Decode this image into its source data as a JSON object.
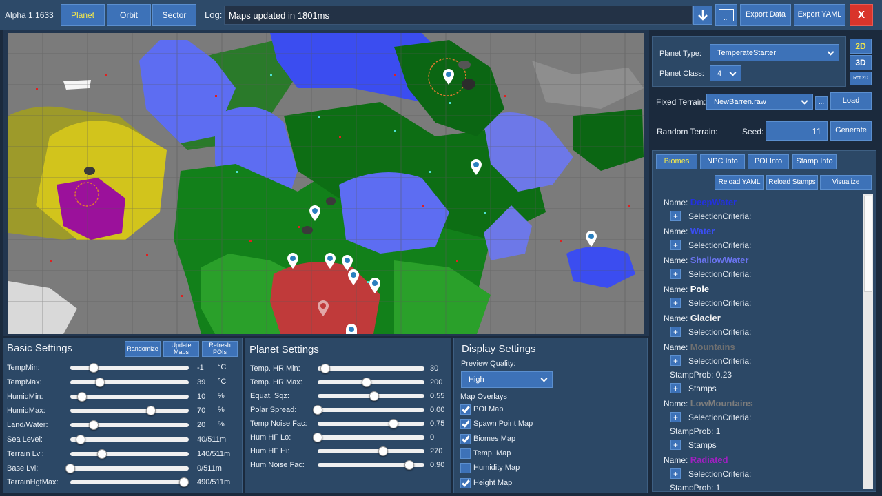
{
  "top_bar": {
    "version": "Alpha 1.1633",
    "tabs": [
      {
        "label": "Planet"
      },
      {
        "label": "Orbit"
      },
      {
        "label": "Sector"
      }
    ],
    "log_label": "Log:",
    "log_text": "Maps updated in 1801ms",
    "browse_label": "...",
    "export_data_label": "Export Data",
    "export_yaml_label": "Export YAML",
    "close_label": "X"
  },
  "planet_config": {
    "planet_type_label": "Planet Type:",
    "planet_type_value": "TemperateStarter",
    "planet_class_label": "Planet Class:",
    "planet_class_value": "4",
    "view_2d_label": "2D",
    "view_3d_label": "3D",
    "rot_2d_label": "Rot 2D",
    "fixed_terrain_label": "Fixed Terrain:",
    "fixed_terrain_value": "NewBarren.raw",
    "browse_label": "...",
    "load_label": "Load",
    "random_terrain_label": "Random Terrain:",
    "seed_label": "Seed:",
    "seed_value": "11",
    "generate_label": "Generate"
  },
  "info_tabs": [
    {
      "label": "Biomes"
    },
    {
      "label": "NPC Info"
    },
    {
      "label": "POI Info"
    },
    {
      "label": "Stamp Info"
    }
  ],
  "info_actions": {
    "reload_yaml": "Reload YAML",
    "reload_stamps": "Reload Stamps",
    "visualize": "Visualize"
  },
  "biomes": {
    "name_label": "Name:",
    "plus": "+",
    "rows": [
      {
        "kind": "name",
        "value": "DeepWater",
        "color": "#2230e0"
      },
      {
        "kind": "sub",
        "value": "SelectionCriteria:",
        "plus": true
      },
      {
        "kind": "name",
        "value": "Water",
        "color": "#3a4ef5"
      },
      {
        "kind": "sub",
        "value": "SelectionCriteria:",
        "plus": true
      },
      {
        "kind": "name",
        "value": "ShallowWater",
        "color": "#6a74f0"
      },
      {
        "kind": "sub",
        "value": "SelectionCriteria:",
        "plus": true
      },
      {
        "kind": "name",
        "value": "Pole",
        "color": "#ffffff"
      },
      {
        "kind": "sub",
        "value": "SelectionCriteria:",
        "plus": true
      },
      {
        "kind": "name",
        "value": "Glacier",
        "color": "#f4f4f4"
      },
      {
        "kind": "sub",
        "value": "SelectionCriteria:",
        "plus": true
      },
      {
        "kind": "name",
        "value": "Mountains",
        "color": "#707070"
      },
      {
        "kind": "sub",
        "value": "SelectionCriteria:",
        "plus": true
      },
      {
        "kind": "prop",
        "value": "StampProb: 0.23"
      },
      {
        "kind": "sub",
        "value": "Stamps",
        "plus": true
      },
      {
        "kind": "name",
        "value": "LowMountains",
        "color": "#7c7c7c"
      },
      {
        "kind": "sub",
        "value": "SelectionCriteria:",
        "plus": true
      },
      {
        "kind": "prop",
        "value": "StampProb: 1"
      },
      {
        "kind": "sub",
        "value": "Stamps",
        "plus": true
      },
      {
        "kind": "name",
        "value": "Radiated",
        "color": "#a020c0"
      },
      {
        "kind": "sub",
        "value": "SelectionCriteria:",
        "plus": true
      },
      {
        "kind": "prop",
        "value": "StampProb: 1"
      }
    ]
  },
  "basic_settings": {
    "title": "Basic Settings",
    "randomize_label": "Randomize",
    "update_maps_label": "Update Maps",
    "refresh_pois_label": "Refresh POIs",
    "sliders": [
      {
        "label": "TempMin:",
        "value": "-1",
        "unit": "°C",
        "level": 0.2
      },
      {
        "label": "TempMax:",
        "value": "39",
        "unit": "°C",
        "level": 0.25
      },
      {
        "label": "HumidMin:",
        "value": "10",
        "unit": "%",
        "level": 0.1
      },
      {
        "label": "HumidMax:",
        "value": "70",
        "unit": "%",
        "level": 0.68
      },
      {
        "label": "Land/Water:",
        "value": "20",
        "unit": "%",
        "level": 0.2
      },
      {
        "label": "Sea Level:",
        "value": "40/511m",
        "unit": "",
        "level": 0.09
      },
      {
        "label": "Terrain Lvl:",
        "value": "140/511m",
        "unit": "",
        "level": 0.27
      },
      {
        "label": "Base Lvl:",
        "value": "0/511m",
        "unit": "",
        "level": 0.0
      },
      {
        "label": "TerrainHgtMax:",
        "value": "490/511m",
        "unit": "",
        "level": 0.96
      }
    ]
  },
  "planet_settings": {
    "title": "Planet Settings",
    "sliders": [
      {
        "label": "Temp. HR Min:",
        "value": "30",
        "level": 0.07
      },
      {
        "label": "Temp. HR Max:",
        "value": "200",
        "level": 0.46
      },
      {
        "label": "Equat. Sqz:",
        "value": "0.55",
        "level": 0.53
      },
      {
        "label": "Polar Spread:",
        "value": "0.00",
        "level": 0.0
      },
      {
        "label": "Temp Noise Fac:",
        "value": "0.75",
        "level": 0.71
      },
      {
        "label": "Hum HF Lo:",
        "value": "0",
        "level": 0.0
      },
      {
        "label": "Hum HF Hi:",
        "value": "270",
        "level": 0.61
      },
      {
        "label": "Hum Noise Fac:",
        "value": "0.90",
        "level": 0.86
      }
    ]
  },
  "display_settings": {
    "title": "Display Settings",
    "preview_quality_label": "Preview Quality:",
    "preview_quality_value": "High",
    "overlays_label": "Map Overlays",
    "overlays": [
      {
        "label": "POI Map",
        "checked": true
      },
      {
        "label": "Spawn Point Map",
        "checked": true
      },
      {
        "label": "Biomes Map",
        "checked": true
      },
      {
        "label": "Temp. Map",
        "checked": false
      },
      {
        "label": "Humidity Map",
        "checked": false
      },
      {
        "label": "Height Map",
        "checked": true
      }
    ]
  },
  "colors": {
    "accent": "#3d72b8",
    "panel": "#2c4866",
    "close": "#d9342b"
  }
}
